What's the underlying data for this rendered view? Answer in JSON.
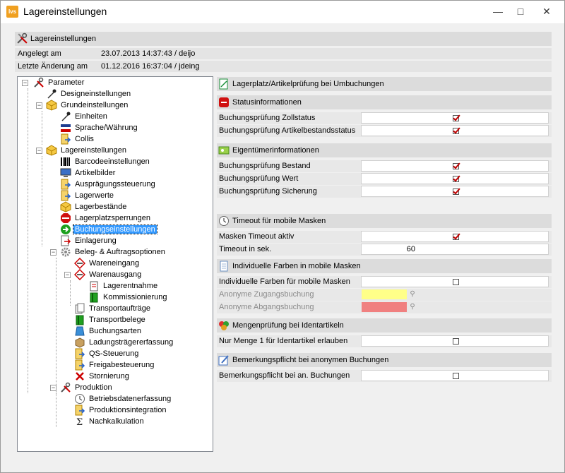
{
  "window": {
    "title": "Lagereinstellungen",
    "app_icon_text": "lvs"
  },
  "header": {
    "title": "Lagereinstellungen",
    "created_label": "Angelegt am",
    "created_value": "23.07.2013 14:37:43 / deijo",
    "changed_label": "Letzte Änderung am",
    "changed_value": "01.12.2016 16:37:04 / jdeing"
  },
  "tree": {
    "root": "Parameter",
    "items": [
      "Designeinstellungen",
      "Grundeinstellungen",
      "Einheiten",
      "Sprache/Währung",
      "Collis",
      "Lagereinstellungen",
      "Barcodeeinstellungen",
      "Artikelbilder",
      "Ausprägungssteuerung",
      "Lagerwerte",
      "Lagerbestände",
      "Lagerplatzsperrungen",
      "Buchungseinstellungen",
      "Einlagerung",
      "Beleg- & Auftragsoptionen",
      "Wareneingang",
      "Warenausgang",
      "Lagerentnahme",
      "Kommissionierung",
      "Transportaufträge",
      "Transportbelege",
      "Buchungsarten",
      "Ladungsträgererfassung",
      "QS-Steuerung",
      "Freigabesteuerung",
      "Stornierung",
      "Produktion",
      "Betriebsdatenerfassung",
      "Produktionsintegration",
      "Nachkalkulation"
    ],
    "selected": "Buchungseinstellungen"
  },
  "panel": {
    "title": "Lagerplatz/Artikelprüfung bei Umbuchungen",
    "sections": [
      {
        "title": "Statusinformationen",
        "rows": [
          {
            "label": "Buchungsprüfung Zollstatus",
            "type": "checkbox",
            "checked": true
          },
          {
            "label": "Buchungsprüfung Artikelbestandsstatus",
            "type": "checkbox",
            "checked": true
          }
        ]
      },
      {
        "title": "Eigentümerinformationen",
        "rows": [
          {
            "label": "Buchungsprüfung Bestand",
            "type": "checkbox",
            "checked": true
          },
          {
            "label": "Buchungsprüfung Wert",
            "type": "checkbox",
            "checked": true
          },
          {
            "label": "Buchungsprüfung Sicherung",
            "type": "checkbox",
            "checked": true
          }
        ]
      },
      {
        "title": "Timeout für mobile Masken",
        "rows": [
          {
            "label": "Masken Timeout aktiv",
            "type": "checkbox",
            "checked": true
          },
          {
            "label": "Timeout in sek.",
            "type": "number",
            "value": "60"
          }
        ]
      },
      {
        "title": "Individuelle Farben in mobile Masken",
        "rows": [
          {
            "label": "Individuelle Farben für mobile Masken",
            "type": "checkbox",
            "checked": false
          },
          {
            "label": "Anonyme Zugangsbuchung",
            "type": "color",
            "color": "#ffff88",
            "disabled": true
          },
          {
            "label": "Anonyme Abgangsbuchung",
            "type": "color",
            "color": "#f08080",
            "disabled": true
          }
        ]
      },
      {
        "title": "Mengenprüfung bei Identartikeln",
        "rows": [
          {
            "label": "Nur Menge 1 für Identartikel erlauben",
            "type": "checkbox",
            "checked": false
          }
        ]
      },
      {
        "title": "Bemerkungspflicht bei anonymen Buchungen",
        "rows": [
          {
            "label": "Bemerkungspflicht bei an. Buchungen",
            "type": "checkbox",
            "checked": false
          }
        ]
      }
    ]
  },
  "colors": {
    "selection": "#3399ff",
    "check": "#c00000",
    "section_bg": "#dcdcdc"
  },
  "icons": [
    "app-icon",
    "tools-icon",
    "gear-icon",
    "cube-icon",
    "barcode-icon",
    "monitor-icon",
    "folder-arrow-icon",
    "stop-icon",
    "arrow-right-icon",
    "clock-icon",
    "document-icon",
    "hearts-icon",
    "pencil-note-icon",
    "sigma-icon",
    "cross-icon"
  ]
}
